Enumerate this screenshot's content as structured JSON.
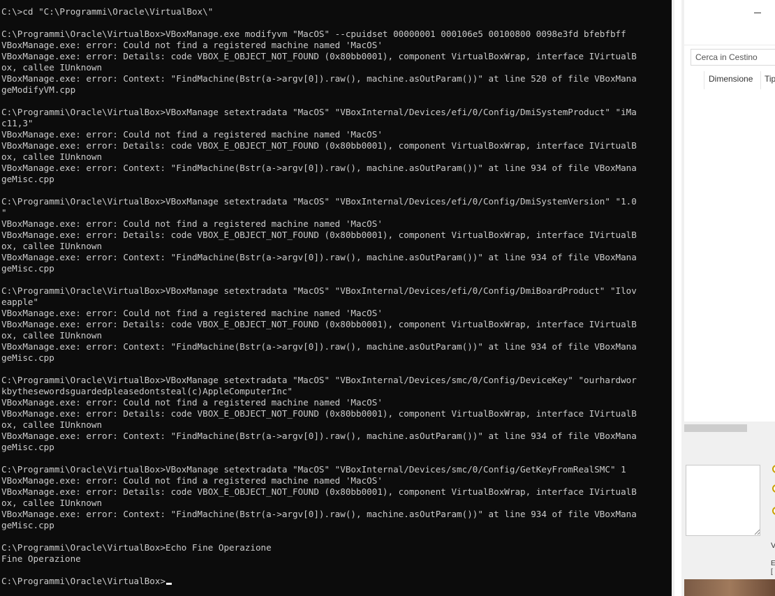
{
  "console": {
    "lines": [
      "C:\\>cd \"C:\\Programmi\\Oracle\\VirtualBox\\\"",
      "",
      "C:\\Programmi\\Oracle\\VirtualBox>VBoxManage.exe modifyvm \"MacOS\" --cpuidset 00000001 000106e5 00100800 0098e3fd bfebfbff",
      "VBoxManage.exe: error: Could not find a registered machine named 'MacOS'",
      "VBoxManage.exe: error: Details: code VBOX_E_OBJECT_NOT_FOUND (0x80bb0001), component VirtualBoxWrap, interface IVirtualB",
      "ox, callee IUnknown",
      "VBoxManage.exe: error: Context: \"FindMachine(Bstr(a->argv[0]).raw(), machine.asOutParam())\" at line 520 of file VBoxMana",
      "geModifyVM.cpp",
      "",
      "C:\\Programmi\\Oracle\\VirtualBox>VBoxManage setextradata \"MacOS\" \"VBoxInternal/Devices/efi/0/Config/DmiSystemProduct\" \"iMa",
      "c11,3\"",
      "VBoxManage.exe: error: Could not find a registered machine named 'MacOS'",
      "VBoxManage.exe: error: Details: code VBOX_E_OBJECT_NOT_FOUND (0x80bb0001), component VirtualBoxWrap, interface IVirtualB",
      "ox, callee IUnknown",
      "VBoxManage.exe: error: Context: \"FindMachine(Bstr(a->argv[0]).raw(), machine.asOutParam())\" at line 934 of file VBoxMana",
      "geMisc.cpp",
      "",
      "C:\\Programmi\\Oracle\\VirtualBox>VBoxManage setextradata \"MacOS\" \"VBoxInternal/Devices/efi/0/Config/DmiSystemVersion\" \"1.0",
      "\"",
      "VBoxManage.exe: error: Could not find a registered machine named 'MacOS'",
      "VBoxManage.exe: error: Details: code VBOX_E_OBJECT_NOT_FOUND (0x80bb0001), component VirtualBoxWrap, interface IVirtualB",
      "ox, callee IUnknown",
      "VBoxManage.exe: error: Context: \"FindMachine(Bstr(a->argv[0]).raw(), machine.asOutParam())\" at line 934 of file VBoxMana",
      "geMisc.cpp",
      "",
      "C:\\Programmi\\Oracle\\VirtualBox>VBoxManage setextradata \"MacOS\" \"VBoxInternal/Devices/efi/0/Config/DmiBoardProduct\" \"Ilov",
      "eapple\"",
      "VBoxManage.exe: error: Could not find a registered machine named 'MacOS'",
      "VBoxManage.exe: error: Details: code VBOX_E_OBJECT_NOT_FOUND (0x80bb0001), component VirtualBoxWrap, interface IVirtualB",
      "ox, callee IUnknown",
      "VBoxManage.exe: error: Context: \"FindMachine(Bstr(a->argv[0]).raw(), machine.asOutParam())\" at line 934 of file VBoxMana",
      "geMisc.cpp",
      "",
      "C:\\Programmi\\Oracle\\VirtualBox>VBoxManage setextradata \"MacOS\" \"VBoxInternal/Devices/smc/0/Config/DeviceKey\" \"ourhardwor",
      "kbythesewordsguardedpleasedontsteal(c)AppleComputerInc\"",
      "VBoxManage.exe: error: Could not find a registered machine named 'MacOS'",
      "VBoxManage.exe: error: Details: code VBOX_E_OBJECT_NOT_FOUND (0x80bb0001), component VirtualBoxWrap, interface IVirtualB",
      "ox, callee IUnknown",
      "VBoxManage.exe: error: Context: \"FindMachine(Bstr(a->argv[0]).raw(), machine.asOutParam())\" at line 934 of file VBoxMana",
      "geMisc.cpp",
      "",
      "C:\\Programmi\\Oracle\\VirtualBox>VBoxManage setextradata \"MacOS\" \"VBoxInternal/Devices/smc/0/Config/GetKeyFromRealSMC\" 1",
      "VBoxManage.exe: error: Could not find a registered machine named 'MacOS'",
      "VBoxManage.exe: error: Details: code VBOX_E_OBJECT_NOT_FOUND (0x80bb0001), component VirtualBoxWrap, interface IVirtualB",
      "ox, callee IUnknown",
      "VBoxManage.exe: error: Context: \"FindMachine(Bstr(a->argv[0]).raw(), machine.asOutParam())\" at line 934 of file VBoxMana",
      "geMisc.cpp",
      "",
      "C:\\Programmi\\Oracle\\VirtualBox>Echo Fine Operazione",
      "Fine Operazione",
      "",
      "C:\\Programmi\\Oracle\\VirtualBox>"
    ],
    "colors": {
      "background": "#0c0c0c",
      "text": "#cccccc"
    }
  },
  "explorer": {
    "search_placeholder": "Cerca in Cestino",
    "columns": [
      "Dimensione",
      "Tipo"
    ],
    "minimize_icon": "minimize-icon"
  },
  "bottom_panel": {
    "label_v": "V",
    "label_e": "E",
    "label_b": "["
  }
}
